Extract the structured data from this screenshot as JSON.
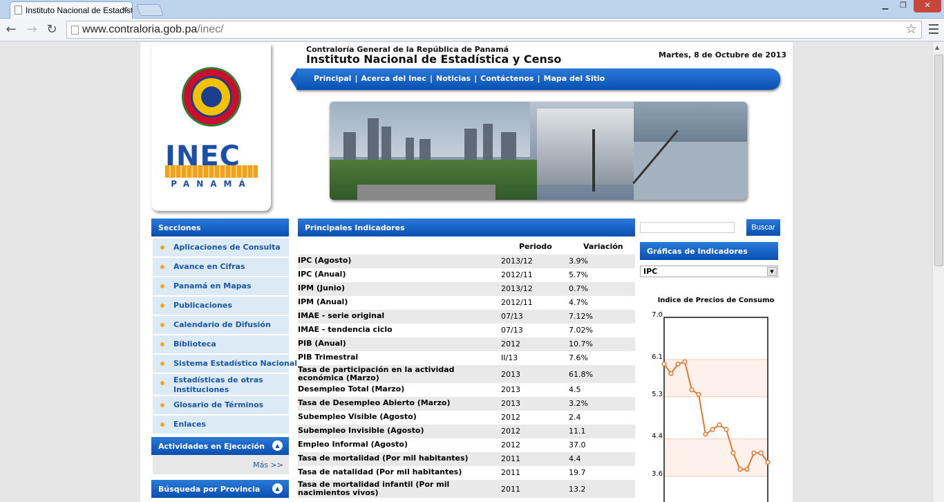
{
  "browser": {
    "tab_title": "Instituto Nacional de Estadística y Censo",
    "url_domain": "www.contraloria.gob.pa",
    "url_path": "/inec/"
  },
  "header": {
    "org": "Contraloría General de la República de Panamá",
    "institute": "Instituto Nacional de Estadística y Censo",
    "date": "Martes, 8 de Octubre de 2013"
  },
  "logo": {
    "word": "INEC",
    "country": "PANAMÁ"
  },
  "nav": [
    "Principal",
    "Acerca del Inec",
    "Noticias",
    "Contáctenos",
    "Mapa del Sitio"
  ],
  "sections": {
    "title": "Secciones",
    "items": [
      "Aplicaciones de Consulta",
      "Avance en Cifras",
      "Panamá en Mapas",
      "Publicaciones",
      "Calendario de Difusión",
      "Biblioteca",
      "Sistema Estadístico Nacional",
      "Estadísticas de otras Instituciones",
      "Glosario de Términos",
      "Enlaces"
    ]
  },
  "activities": {
    "title": "Actividades en Ejecución",
    "more": "Más >>"
  },
  "province": {
    "title": "Búsqueda por Provincia"
  },
  "indicators": {
    "title": "Principales Indicadores",
    "col_period": "Periodo",
    "col_variation": "Variación",
    "rows": [
      {
        "name": "IPC (Agosto)",
        "period": "2013/12",
        "variation": "3.9%"
      },
      {
        "name": "IPC (Anual)",
        "period": "2012/11",
        "variation": "5.7%"
      },
      {
        "name": "IPM (Junio)",
        "period": "2013/12",
        "variation": "0.7%"
      },
      {
        "name": "IPM (Anual)",
        "period": "2012/11",
        "variation": "4.7%"
      },
      {
        "name": "IMAE - serie original",
        "period": "07/13",
        "variation": "7.12%"
      },
      {
        "name": "IMAE - tendencia ciclo",
        "period": "07/13",
        "variation": "7.02%"
      },
      {
        "name": "PIB (Anual)",
        "period": "2012",
        "variation": "10.7%"
      },
      {
        "name": "PIB Trimestral",
        "period": "II/13",
        "variation": "7.6%"
      },
      {
        "name": "Tasa de participación en la actividad económica (Marzo)",
        "period": "2013",
        "variation": "61.8%"
      },
      {
        "name": "Desempleo Total (Marzo)",
        "period": "2013",
        "variation": "4.5"
      },
      {
        "name": "Tasa de Desempleo Abierto (Marzo)",
        "period": "2013",
        "variation": "3.2%"
      },
      {
        "name": "Subempleo Visible (Agosto)",
        "period": "2012",
        "variation": "2.4"
      },
      {
        "name": "Subempleo Invisible (Agosto)",
        "period": "2012",
        "variation": "11.1"
      },
      {
        "name": "Empleo Informal (Agosto)",
        "period": "2012",
        "variation": "37.0"
      },
      {
        "name": "Tasa de mortalidad (Por mil habitantes)",
        "period": "2011",
        "variation": "4.4"
      },
      {
        "name": "Tasa de natalidad (Por mil habitantes)",
        "period": "2011",
        "variation": "19.7"
      },
      {
        "name": "Tasa de mortalidad infantil (Por mil nacimientos vivos)",
        "period": "2011",
        "variation": "13.2"
      }
    ]
  },
  "search": {
    "button": "Buscar"
  },
  "charts_panel": {
    "title": "Gráficas de Indicadores",
    "selected": "IPC"
  },
  "chart_data": {
    "type": "line",
    "title": "Indice de Precios de Consumo",
    "ylim": [
      3.6,
      7.0
    ],
    "yticks": [
      "7.0",
      "6.1",
      "5.3",
      "4.4",
      "3.6"
    ],
    "values": [
      6.0,
      5.8,
      6.0,
      6.05,
      5.45,
      5.35,
      4.5,
      4.6,
      4.7,
      4.6,
      4.1,
      3.75,
      3.75,
      4.1,
      4.1,
      3.9
    ],
    "color": "#e8742a"
  }
}
